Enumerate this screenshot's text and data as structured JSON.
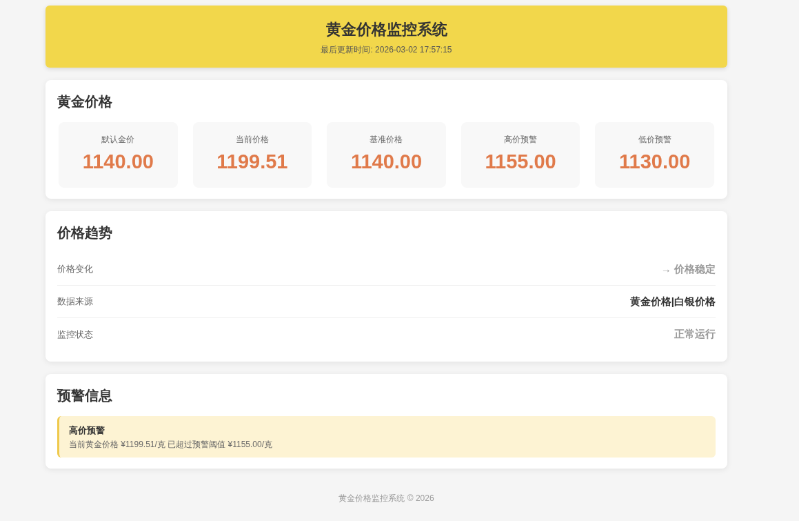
{
  "header": {
    "title": "黄金价格监控系统",
    "updated": "最后更新时间: 2026-03-02 17:57:15"
  },
  "prices": {
    "title": "黄金价格",
    "items": [
      {
        "label": "默认金价",
        "value": "1140.00"
      },
      {
        "label": "当前价格",
        "value": "1199.51"
      },
      {
        "label": "基准价格",
        "value": "1140.00"
      },
      {
        "label": "高价预警",
        "value": "1155.00"
      },
      {
        "label": "低价预警",
        "value": "1130.00"
      }
    ]
  },
  "trend": {
    "title": "价格趋势",
    "rows": [
      {
        "label": "价格变化",
        "value": "→ 价格稳定",
        "emphasized": false
      },
      {
        "label": "数据来源",
        "value": "黄金价格|白银价格",
        "emphasized": true
      },
      {
        "label": "监控状态",
        "value": "正常运行",
        "emphasized": false
      }
    ]
  },
  "alerts": {
    "title": "预警信息",
    "items": [
      {
        "kind": "high",
        "title": "高价预警",
        "message": "当前黄金价格 ¥1199.51/克 已超过预警阈值 ¥1155.00/克"
      }
    ]
  },
  "footer": "黄金价格监控系统 © 2026"
}
